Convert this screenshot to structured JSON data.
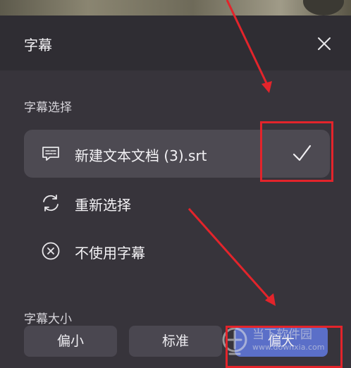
{
  "panel": {
    "title": "字幕"
  },
  "subtitle_select": {
    "heading": "字幕选择",
    "options": [
      {
        "label": "新建文本文档 (3).srt",
        "icon": "subtitle-file-icon",
        "selected": true
      },
      {
        "label": "重新选择",
        "icon": "refresh-icon",
        "selected": false
      },
      {
        "label": "不使用字幕",
        "icon": "cancel-circle-icon",
        "selected": false
      }
    ]
  },
  "subtitle_size": {
    "heading": "字幕大小",
    "options": [
      {
        "label": "偏小",
        "selected": false
      },
      {
        "label": "标准",
        "selected": false
      },
      {
        "label": "偏大",
        "selected": true
      }
    ]
  },
  "watermark": {
    "name": "当下软件园",
    "url": "www.downxia.com"
  },
  "colors": {
    "accent": "#5b6fc8",
    "annotation": "#e3242b",
    "panel": "#37343b",
    "header": "#2f2d33"
  }
}
